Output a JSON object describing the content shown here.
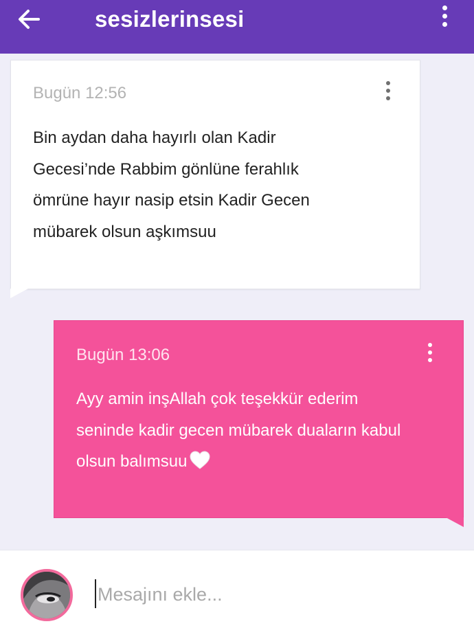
{
  "header": {
    "title": "sesizlerinsesi",
    "back_icon": "arrow-left-icon",
    "menu_icon": "more-vertical-icon",
    "background": "#673bb7"
  },
  "messages": [
    {
      "direction": "incoming",
      "time": "Bugün 12:56",
      "text": "Bin aydan daha hayırlı olan Kadir Gecesi’nde Rabbim gönlüne ferahlık ömrüne hayır nasip etsin Kadir Gecen mübarek olsun aşkımsuu",
      "background": "#ffffff"
    },
    {
      "direction": "outgoing",
      "time": "Bugün 13:06",
      "text": "Ayy amin inşAllah çok teşekkür ederim seninde kadir gecen mübarek duaların kabul olsun balımsuu",
      "emoji": "white-heart-icon",
      "background": "#f4529a"
    }
  ],
  "composer": {
    "placeholder": "Mesajını ekle...",
    "avatar": "user-avatar",
    "avatar_ring_color": "#f26a9c"
  }
}
